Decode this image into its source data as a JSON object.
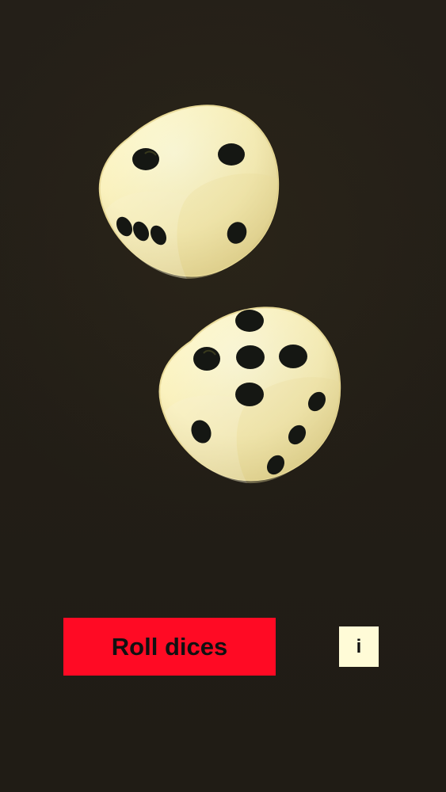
{
  "app": {
    "roll_label": "Roll dices",
    "info_label": "i"
  },
  "dice": [
    {
      "top_face_value": 2,
      "left_face_value": 3,
      "right_face_value": 1
    },
    {
      "top_face_value": 5,
      "left_face_value": 1,
      "right_face_value": 3
    }
  ],
  "colors": {
    "background": "#241f18",
    "button_red": "#ff0a24",
    "info_button": "#fffbd7",
    "die_face": "#fff6bd",
    "die_shadow": "#d9ca84",
    "pip": "#151713"
  }
}
